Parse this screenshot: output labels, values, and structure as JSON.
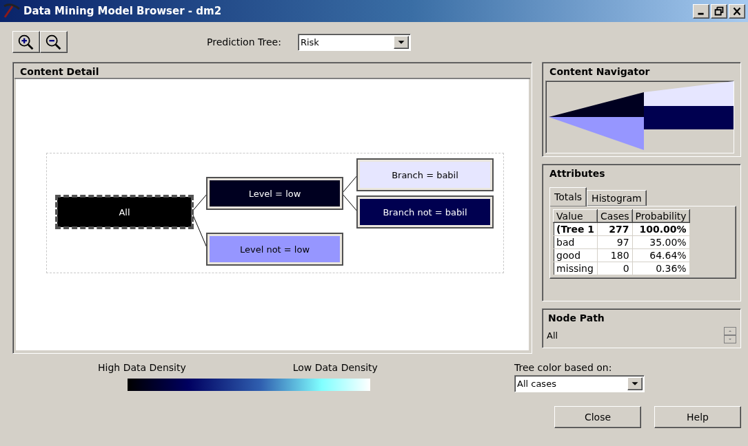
{
  "window": {
    "title": "Data Mining Model Browser - dm2"
  },
  "toolbar": {
    "prediction_tree_label": "Prediction Tree:",
    "prediction_tree": "Risk"
  },
  "content_detail": {
    "title": "Content Detail",
    "tree": {
      "label": "All",
      "color": "#000000",
      "selected": true,
      "children": [
        {
          "label": "Level = low",
          "color": "#000020",
          "selected": false,
          "children": [
            {
              "label": "Branch = babil",
              "color": "#e6e6ff",
              "selected": false
            },
            {
              "label": "Branch not = babil",
              "color": "#000050",
              "selected": false
            }
          ]
        },
        {
          "label": "Level not = low",
          "color": "#9696ff",
          "selected": false
        }
      ]
    }
  },
  "content_navigator": {
    "title": "Content Navigator"
  },
  "attributes": {
    "title": "Attributes",
    "tabs": [
      {
        "label": "Totals",
        "selected": true
      },
      {
        "label": "Histogram",
        "selected": false
      }
    ],
    "columns": [
      "Value",
      "Cases",
      "Probability"
    ],
    "rows": [
      {
        "kind": "total",
        "cells": [
          "(Tree 1",
          "277",
          "100.00%"
        ]
      },
      {
        "kind": "value",
        "cells": [
          "bad",
          "97",
          "35.00%"
        ]
      },
      {
        "kind": "value",
        "cells": [
          "good",
          "180",
          "64.64%"
        ]
      },
      {
        "kind": "value",
        "cells": [
          "missing",
          "0",
          "0.36%"
        ]
      }
    ]
  },
  "node_path": {
    "title": "Node Path",
    "value": "All"
  },
  "legend": {
    "high_label": "High Data Density",
    "low_label": "Low Data Density"
  },
  "tree_color": {
    "label": "Tree color based on:",
    "value": "All cases"
  },
  "buttons": [
    "Close",
    "Help"
  ]
}
